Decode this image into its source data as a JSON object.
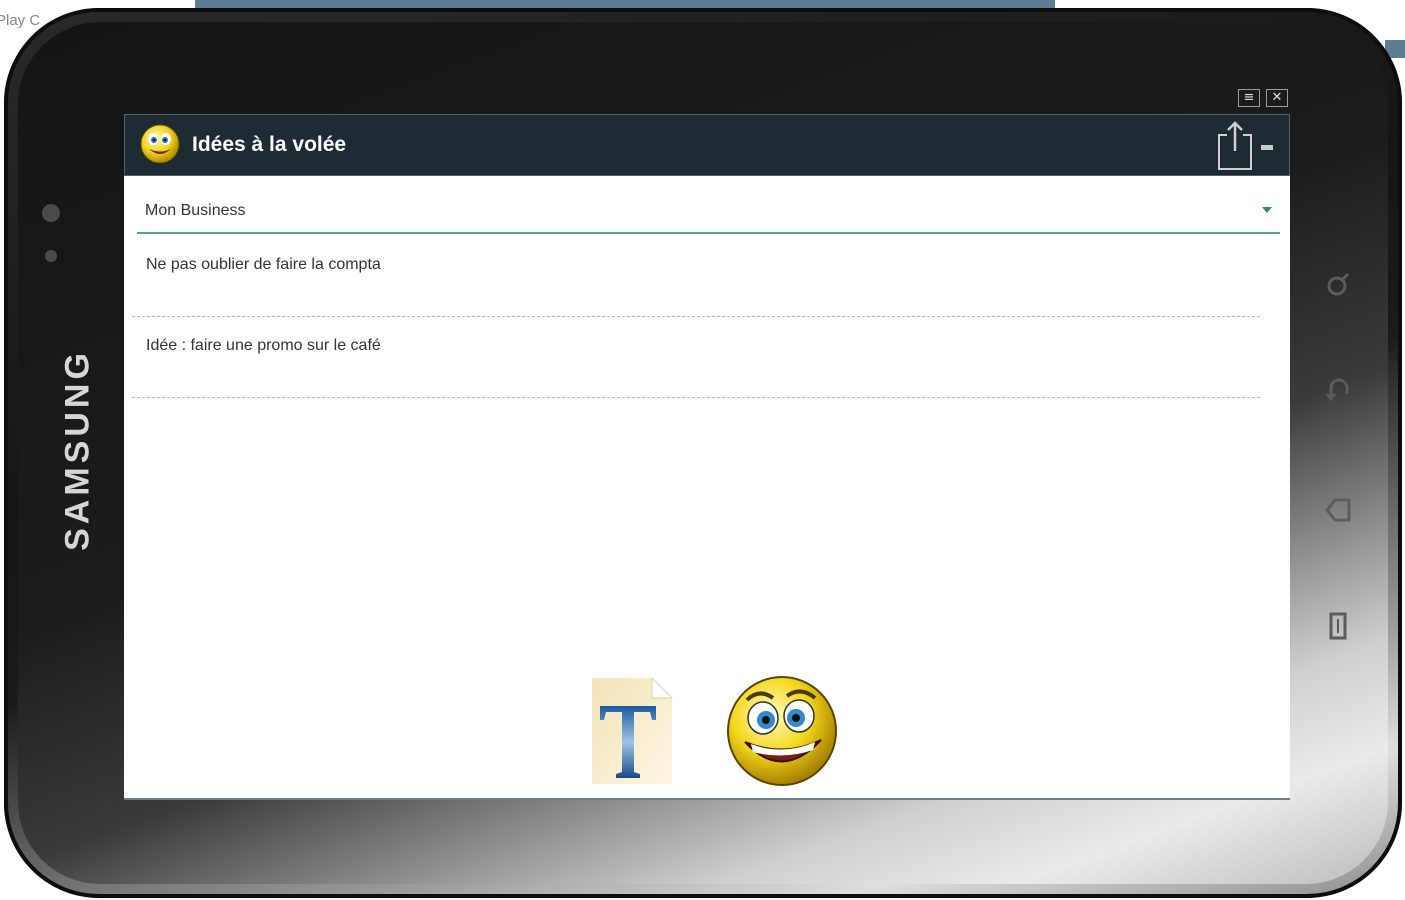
{
  "background": {
    "partial_text": "Play C"
  },
  "device": {
    "brand": "SAMSUNG",
    "hardware_keys": [
      "search-key-icon",
      "back-key-icon",
      "home-key-icon",
      "menu-key-icon"
    ]
  },
  "status_bar": {
    "icons": [
      "menu-lines-icon",
      "close-box-icon"
    ]
  },
  "action_bar": {
    "title": "Idées à la volée",
    "app_icon": "smiley-face-icon",
    "share_icon": "share-icon",
    "overflow_icon": "overflow-icon"
  },
  "category_spinner": {
    "selected": "Mon Business"
  },
  "notes": [
    {
      "text": "Ne pas oublier de faire la compta"
    },
    {
      "text": "Idée : faire une promo sur le café"
    }
  ],
  "bottom_actions": [
    {
      "icon": "text-document-icon"
    },
    {
      "icon": "smiley-face-icon"
    }
  ],
  "colors": {
    "action_bar_bg": "#1f2b33",
    "accent_underline": "#55a58e",
    "spinner_arrow": "#2f8a70"
  }
}
